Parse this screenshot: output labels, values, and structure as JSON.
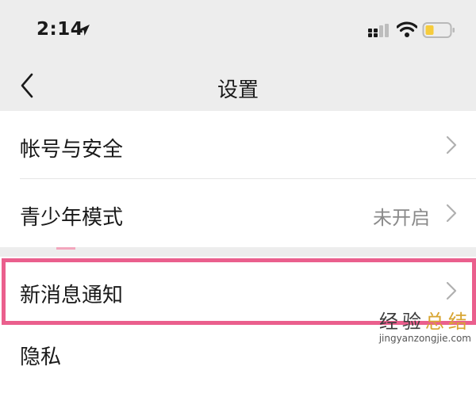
{
  "status_bar": {
    "time": "2:14",
    "icons": [
      "location-arrow-icon",
      "cellular-signal-icon",
      "wifi-icon",
      "battery-icon"
    ]
  },
  "nav": {
    "title": "设置",
    "back_icon": "chevron-left-icon"
  },
  "settings": {
    "items": [
      {
        "label": "帐号与安全",
        "value": ""
      },
      {
        "label": "青少年模式",
        "value": "未开启"
      },
      {
        "label": "新消息通知",
        "value": "",
        "highlighted": true
      },
      {
        "label": "隐私",
        "value": ""
      }
    ]
  },
  "watermark": {
    "main_part1": "经验",
    "main_part2": "总结",
    "sub": "jingyanzongjie.com"
  },
  "colors": {
    "background": "#ededed",
    "highlight_border": "#ea5f8d",
    "battery_fill": "#f6cc3c",
    "secondary_text": "#8a8a8a"
  }
}
